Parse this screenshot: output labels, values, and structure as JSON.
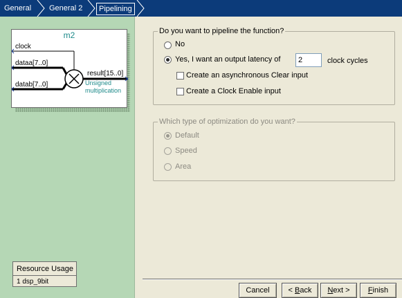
{
  "wizard_steps": [
    {
      "label": "General"
    },
    {
      "label": "General 2"
    },
    {
      "label": "Pipelining"
    }
  ],
  "symbol": {
    "title": "m2",
    "ports": {
      "clock": "clock",
      "dataa": "dataa[7..0]",
      "datab": "datab[7..0]",
      "result": "result[15..0]"
    },
    "operation_line1": "Unsigned",
    "operation_line2": "multiplication"
  },
  "resource_usage": {
    "title": "Resource Usage",
    "value": "1 dsp_9bit"
  },
  "pipeline_group": {
    "legend": "Do you want to pipeline the function?",
    "no_label": "No",
    "yes_label": "Yes, I want an output latency of",
    "latency_value": "2",
    "latency_unit": "clock cycles",
    "selected": "yes",
    "async_clear_label": "Create an asynchronous Clear input",
    "async_clear_checked": false,
    "clock_enable_label": "Create a Clock Enable input",
    "clock_enable_checked": false
  },
  "optimization_group": {
    "legend": "Which type of optimization do you want?",
    "options": [
      {
        "label": "Default",
        "selected": true
      },
      {
        "label": "Speed",
        "selected": false
      },
      {
        "label": "Area",
        "selected": false
      }
    ],
    "enabled": false
  },
  "buttons": {
    "cancel": "Cancel",
    "back_prefix": "< ",
    "back_mnemonic": "B",
    "back_rest": "ack",
    "next_mnemonic": "N",
    "next_rest": "ext >",
    "finish_mnemonic": "F",
    "finish_rest": "inish"
  },
  "colors": {
    "stepbar_bg": "#0c3b7a",
    "left_panel_bg": "#b5d7b5",
    "symbol_accent": "#1e8a8a",
    "window_bg": "#ece9d8"
  }
}
